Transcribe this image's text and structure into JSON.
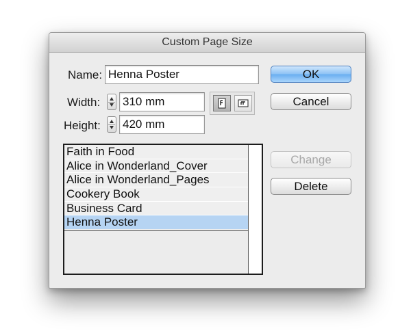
{
  "dialog": {
    "title": "Custom Page Size",
    "name_label": "Name:",
    "name_value": "Henna Poster",
    "width_label": "Width:",
    "width_value": "310 mm",
    "height_label": "Height:",
    "height_value": "420 mm",
    "orientation": {
      "selected": "portrait",
      "portrait_icon": "portrait-orientation-icon",
      "landscape_icon": "landscape-orientation-icon"
    },
    "buttons": {
      "ok": "OK",
      "cancel": "Cancel",
      "change": "Change",
      "delete": "Delete"
    },
    "presets": [
      "Faith in Food",
      "Alice in Wonderland_Cover",
      "Alice in Wonderland_Pages",
      "Cookery Book",
      "Business Card",
      "Henna Poster"
    ],
    "selected_preset_index": 5
  }
}
